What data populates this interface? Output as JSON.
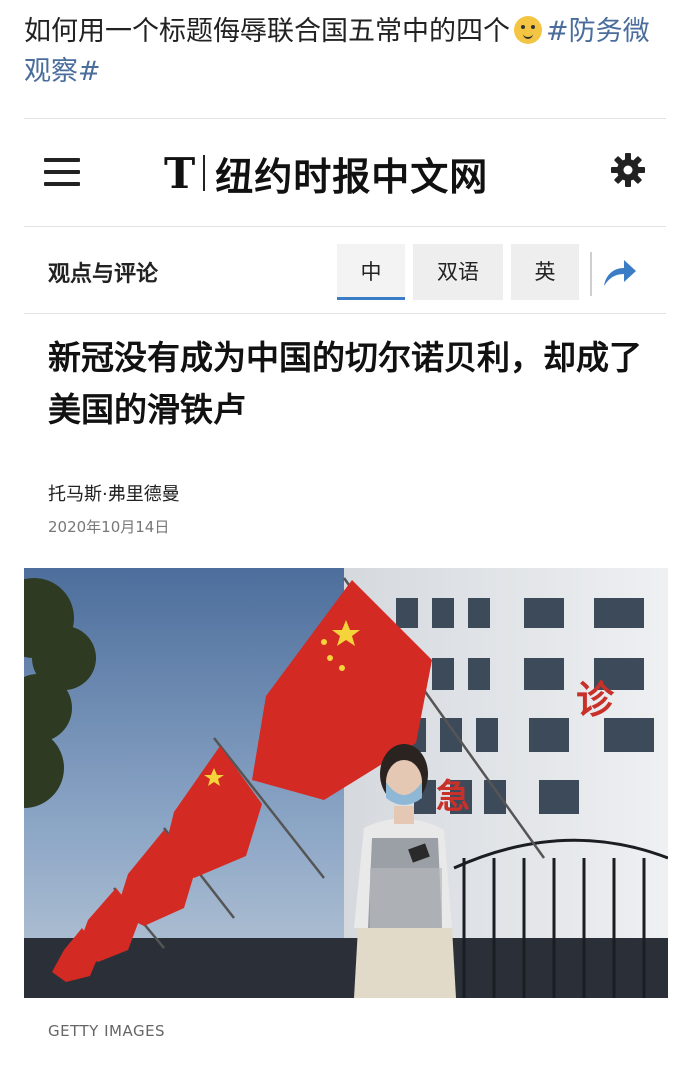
{
  "post": {
    "text": "如何用一个标题侮辱联合国五常中的四个",
    "emoji": "doge-emoji",
    "hashtag": "#防务微观察#"
  },
  "header": {
    "logo_mark": "T",
    "logo_text": "纽约时报中文网",
    "menu_icon": "hamburger-menu-icon",
    "settings_icon": "gear-icon"
  },
  "section": {
    "label": "观点与评论",
    "tabs": [
      {
        "label": "中",
        "active": true
      },
      {
        "label": "双语",
        "active": false
      },
      {
        "label": "英",
        "active": false
      }
    ],
    "share_icon": "share-arrow-icon",
    "accent_color": "#3b7dc4"
  },
  "article": {
    "headline": "新冠没有成为中国的切尔诺贝利，却成了美国的滑铁卢",
    "author": "托马斯·弗里德曼",
    "date": "2020年10月14日",
    "photo_caption": "GETTY IMAGES"
  },
  "colors": {
    "hashtag": "#4a6d9c",
    "flag_red": "#d42a24",
    "flag_star": "#f5d33a"
  }
}
